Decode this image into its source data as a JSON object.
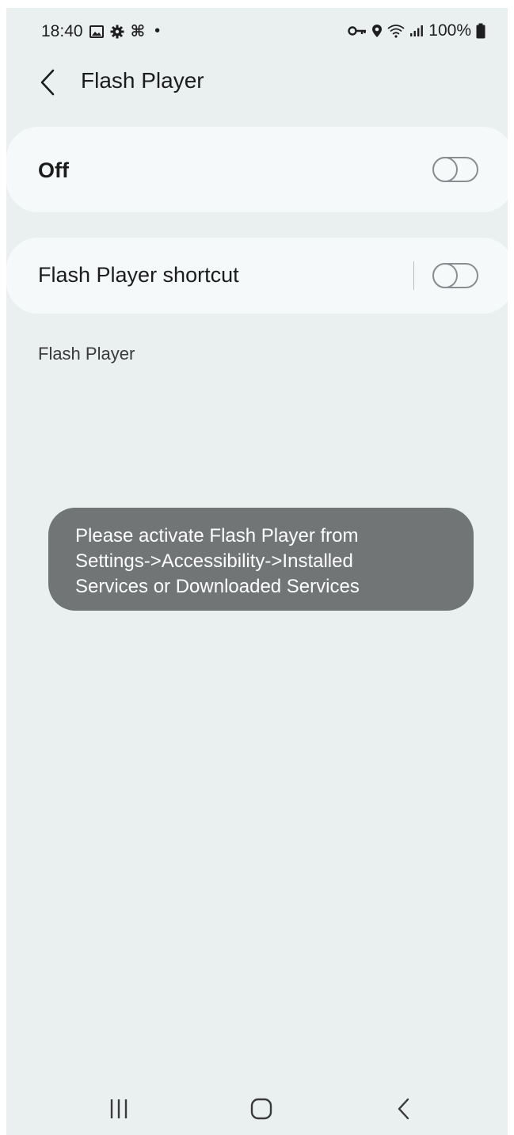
{
  "status_bar": {
    "time": "18:40",
    "left_icons": [
      "gallery-icon",
      "settings-icon",
      "command-icon",
      "dot-icon"
    ],
    "right_icons": [
      "key-icon",
      "location-icon",
      "wifi-icon",
      "signal-icon",
      "battery-icon"
    ],
    "battery_text": "100%",
    "dot": "•",
    "command_glyph": "⌘"
  },
  "app_bar": {
    "title": "Flash Player"
  },
  "main_toggle": {
    "label": "Off",
    "state": "off"
  },
  "shortcut_toggle": {
    "label": "Flash Player shortcut",
    "state": "off"
  },
  "section_caption": "Flash Player",
  "toast": {
    "lines": [
      "Please activate Flash Player from",
      "Settings->Accessibility->Installed",
      "Services or Downloaded Services"
    ]
  },
  "nav_bar": {
    "buttons": [
      "recents-icon",
      "home-icon",
      "back-icon"
    ]
  },
  "colors": {
    "background": "#eaeff0",
    "card": "#f6f9f9",
    "toast": "#717575",
    "switch_off": "#8a8e90"
  }
}
